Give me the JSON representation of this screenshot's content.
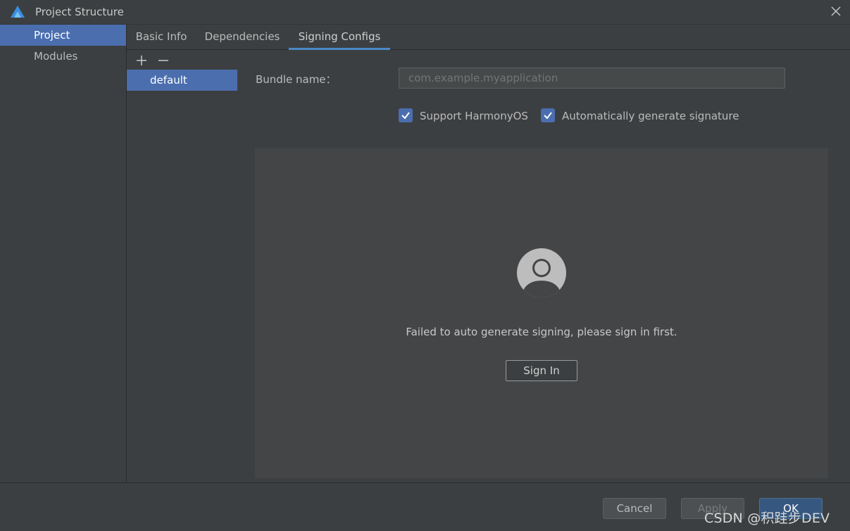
{
  "window": {
    "title": "Project Structure"
  },
  "sidebar": {
    "items": [
      {
        "label": "Project"
      },
      {
        "label": "Modules"
      }
    ]
  },
  "tabs": [
    {
      "label": "Basic Info"
    },
    {
      "label": "Dependencies"
    },
    {
      "label": "Signing Configs"
    }
  ],
  "configs": {
    "items": [
      {
        "label": "default"
      }
    ]
  },
  "form": {
    "bundle_label": "Bundle name：",
    "bundle_placeholder": "com.example.myapplication",
    "support_harmonyos": {
      "label": "Support HarmonyOS",
      "checked": true
    },
    "auto_signature": {
      "label": "Automatically generate signature",
      "checked": true
    }
  },
  "signin": {
    "message": "Failed to auto generate signing, please sign in first.",
    "button": "Sign In"
  },
  "footer": {
    "cancel": "Cancel",
    "apply": "Apply",
    "ok": "OK"
  },
  "watermark": "CSDN @积跬步DEV",
  "colors": {
    "selection": "#4b6eaf",
    "tab_underline": "#4a88c7",
    "background": "#3c3f41"
  },
  "icons": {
    "logo": "deveco-logo-icon",
    "close": "close-icon",
    "add": "add-icon",
    "remove": "remove-icon",
    "avatar": "user-avatar-icon",
    "check": "check-icon"
  }
}
